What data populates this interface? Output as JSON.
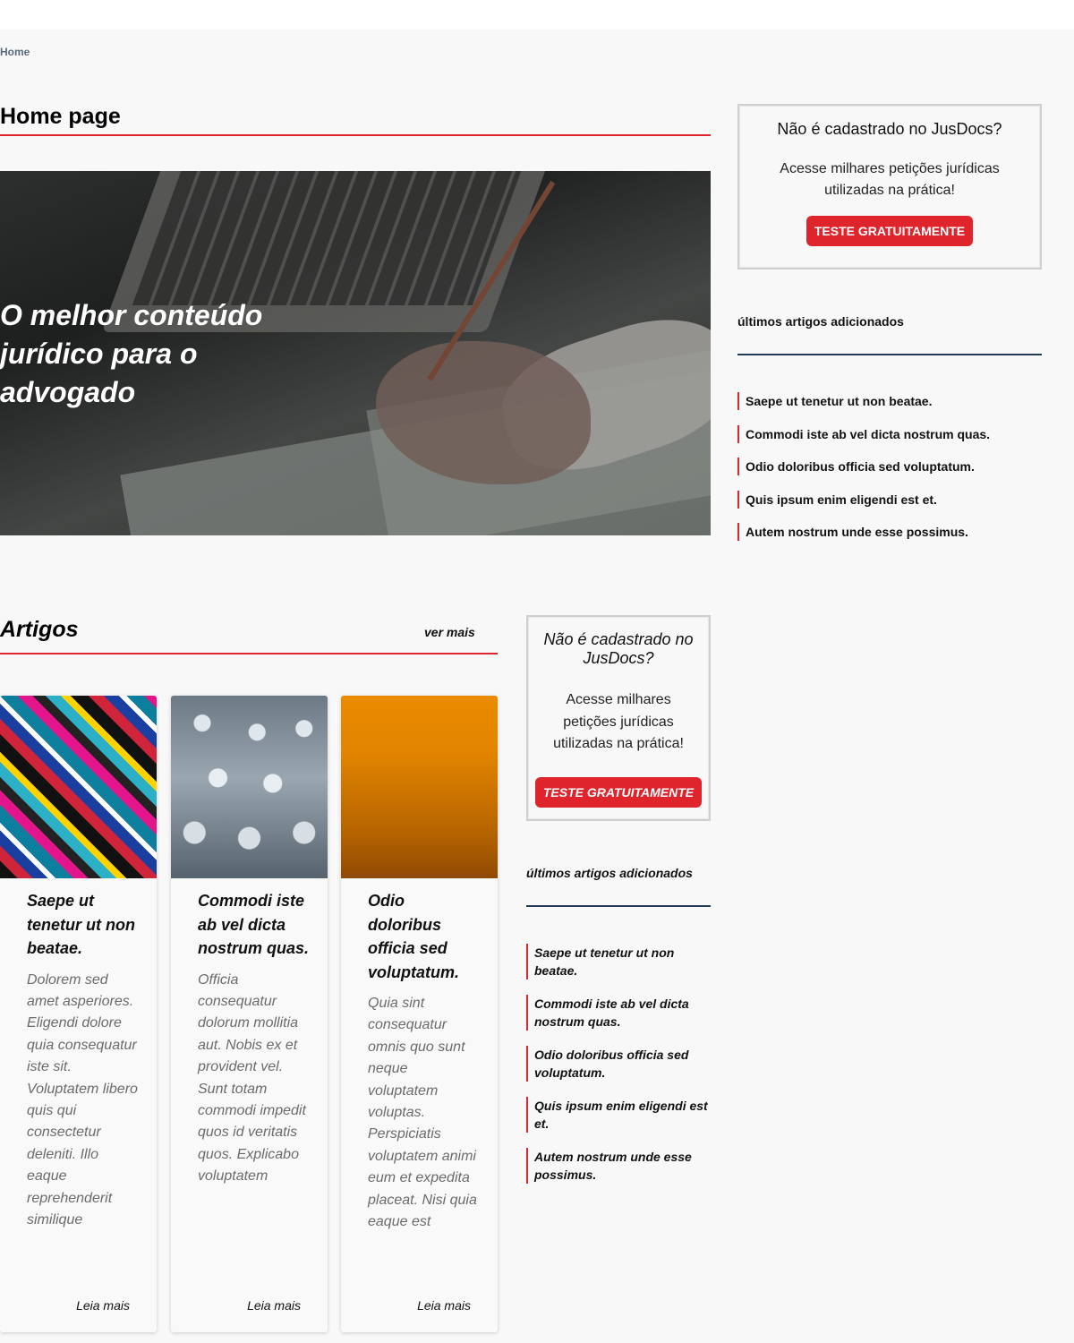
{
  "breadcrumb": {
    "home": "Home"
  },
  "page": {
    "title": "Home page"
  },
  "hero": {
    "title": "O melhor conteúdo jurídico para o advogado"
  },
  "cta": {
    "title": "Não é cadastrado no JusDocs?",
    "text": "Acesse milhares petições jurídicas utilizadas na prática!",
    "button": "TESTE GRATUITAMENTE"
  },
  "latest": {
    "heading": "últimos artigos adicionados",
    "items": [
      "Saepe ut tenetur ut non beatae.",
      "Commodi iste ab vel dicta nostrum quas.",
      "Odio doloribus officia sed voluptatum.",
      "Quis ipsum enim eligendi est et.",
      "Autem nostrum unde esse possimus."
    ]
  },
  "articles": {
    "title": "Artigos",
    "more": "ver mais",
    "cards": [
      {
        "title": "Saepe ut tenetur ut non beatae.",
        "excerpt": "Dolorem sed amet asperiores. Eligendi dolore quia consequatur iste sit. Voluptatem libero quis qui consectetur deleniti. Illo eaque reprehenderit similique",
        "read": "Leia mais"
      },
      {
        "title": "Commodi iste ab vel dicta nostrum quas.",
        "excerpt": "Officia consequatur dolorum mollitia aut. Nobis ex et provident vel. Sunt totam commodi impedit quos id veritatis quos. Explicabo voluptatem",
        "read": "Leia mais"
      },
      {
        "title": "Odio doloribus officia sed voluptatum.",
        "excerpt": "Quia sint consequatur omnis quo sunt neque voluptatem voluptas. Perspiciatis voluptatem animi eum et expedita placeat. Nisi quia eaque est",
        "read": "Leia mais"
      }
    ]
  },
  "colors": {
    "accent": "#e0242c",
    "rule_dark": "#1f3b55",
    "background": "#f8f8f8"
  }
}
